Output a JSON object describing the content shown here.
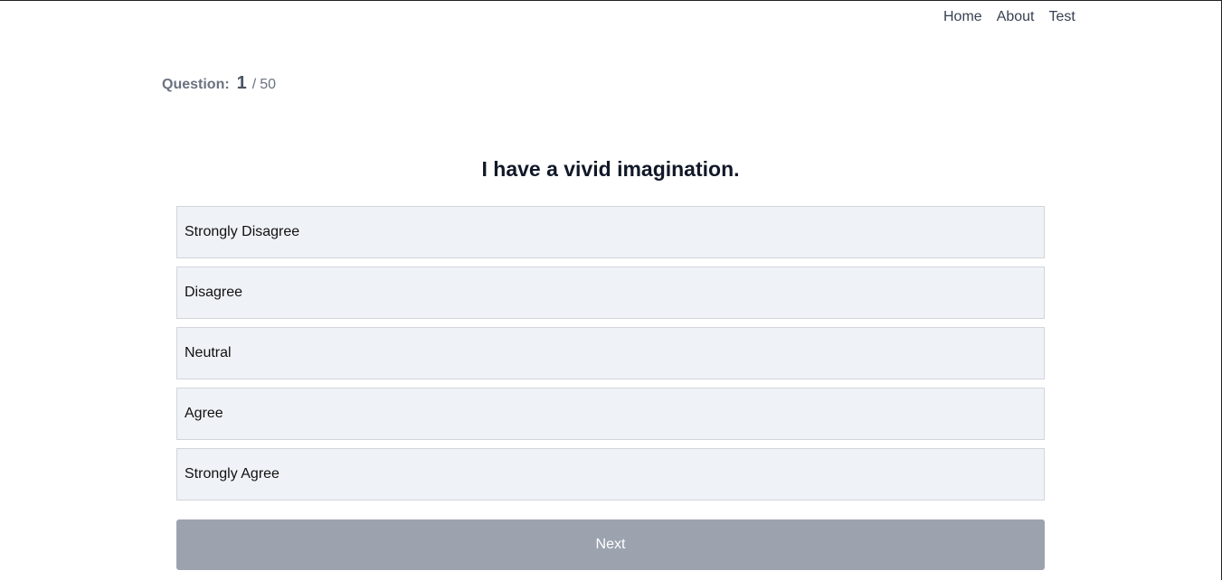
{
  "nav": {
    "items": [
      {
        "label": "Home"
      },
      {
        "label": "About"
      },
      {
        "label": "Test"
      }
    ]
  },
  "progress": {
    "label": "Question:",
    "current": "1",
    "separator": "/",
    "total": "50"
  },
  "question": {
    "text": "I have a vivid imagination."
  },
  "options": [
    {
      "label": "Strongly Disagree"
    },
    {
      "label": "Disagree"
    },
    {
      "label": "Neutral"
    },
    {
      "label": "Agree"
    },
    {
      "label": "Strongly Agree"
    }
  ],
  "actions": {
    "next_label": "Next"
  },
  "colors": {
    "option_bg": "#eff2f7",
    "option_border": "#d1d5db",
    "button_disabled_bg": "#9ca3af",
    "nav_text": "#374151"
  }
}
